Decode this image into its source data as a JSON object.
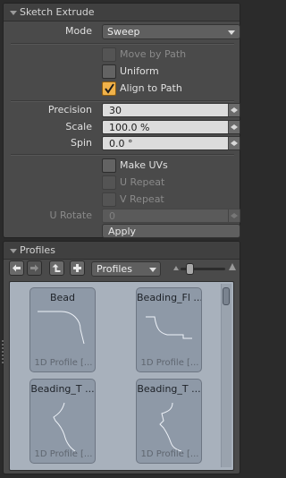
{
  "sketch_extrude": {
    "title": "Sketch Extrude",
    "mode": {
      "label": "Mode",
      "value": "Sweep"
    },
    "move_by_path": {
      "label": "Move by Path",
      "checked": false,
      "enabled": false
    },
    "uniform": {
      "label": "Uniform",
      "checked": false,
      "enabled": true
    },
    "align_to_path": {
      "label": "Align to Path",
      "checked": true,
      "enabled": true
    },
    "precision": {
      "label": "Precision",
      "value": "30"
    },
    "scale": {
      "label": "Scale",
      "value": "100.0 %"
    },
    "spin": {
      "label": "Spin",
      "value": "0.0 °"
    },
    "make_uvs": {
      "label": "Make UVs",
      "checked": false,
      "enabled": true
    },
    "u_repeat": {
      "label": "U Repeat",
      "checked": false,
      "enabled": false
    },
    "v_repeat": {
      "label": "V Repeat",
      "checked": false,
      "enabled": false
    },
    "u_rotate": {
      "label": "U Rotate",
      "value": "0",
      "enabled": false
    },
    "apply_label": "Apply"
  },
  "profiles": {
    "title": "Profiles",
    "filter": "Profiles",
    "toolbar_icons": [
      "arrow-left-icon",
      "arrow-right-icon",
      "level-up-icon",
      "plus-icon"
    ],
    "items": [
      {
        "name": "Bead",
        "type": "1D Profile [..."
      },
      {
        "name": "Beading_Fl ...",
        "type": "1D Profile [..."
      },
      {
        "name": "Beading_T ...",
        "type": "1D Profile [..."
      },
      {
        "name": "Beading_T ...",
        "type": "1D Profile [..."
      }
    ]
  },
  "colors": {
    "accent_check": "#f0b24a",
    "panel_bg": "#4a4a4a",
    "browser_bg": "#a8b1bc"
  }
}
